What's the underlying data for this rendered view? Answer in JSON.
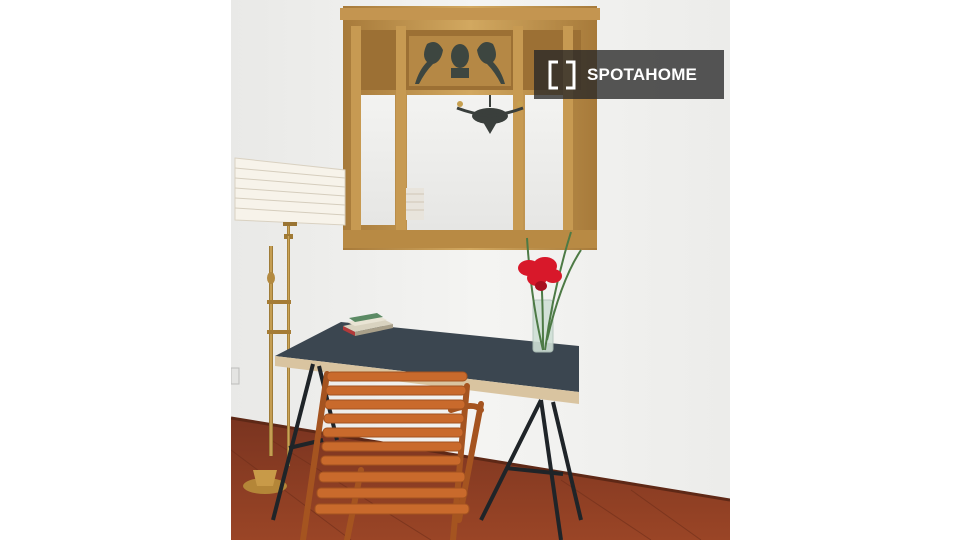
{
  "watermark": {
    "brand_text": "SPOTAHOME",
    "icon": "spotahome-bracket-logo-icon"
  },
  "colors": {
    "wall": "#f1f1ef",
    "floor": "#8a3a22",
    "desk_top": "#3b4650",
    "desk_edge": "#d9c4a0",
    "chair": "#c96a2c",
    "gilt": "#b98a45",
    "flower": "#d8182a",
    "watermark_bg": "#282828"
  }
}
